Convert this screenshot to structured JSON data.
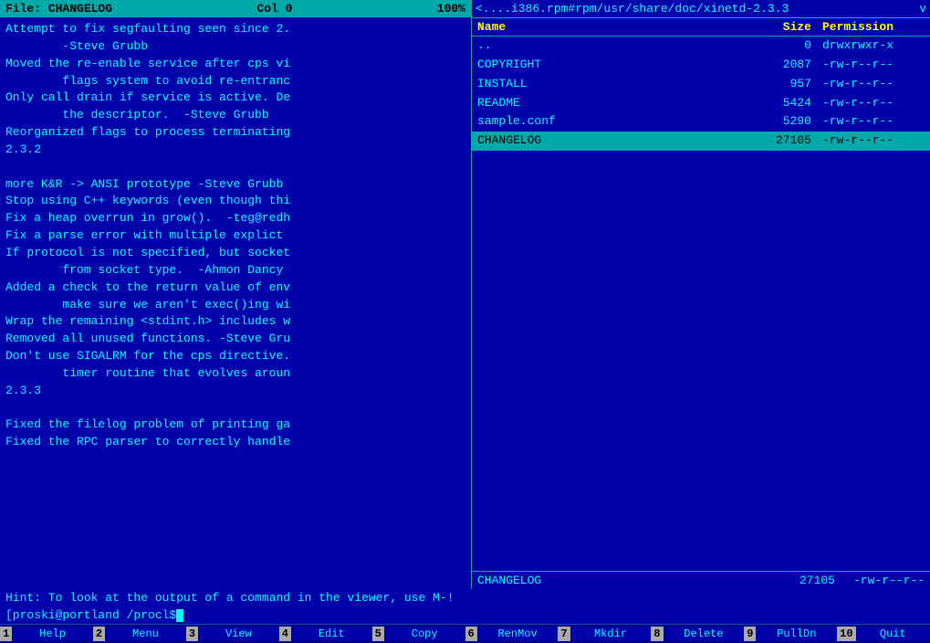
{
  "left": {
    "header": {
      "file_label": "File: CHANGELOG",
      "col_label": "Col 0",
      "percent": "100%"
    },
    "lines": [
      "Attempt to fix segfaulting seen since 2.",
      "        -Steve Grubb",
      "Moved the re-enable service after cps vi",
      "        flags system to avoid re-entranc",
      "Only call drain if service is active. De",
      "        the descriptor.  -Steve Grubb",
      "Reorganized flags to process terminating"
    ],
    "version1": "2.3.2",
    "lines2": [
      "",
      "more K&R -> ANSI prototype -Steve Grubb",
      "Stop using C++ keywords (even though thi",
      "Fix a heap overrun in grow().  -teg@redh",
      "Fix a parse error with multiple explict",
      "If protocol is not specified, but socket",
      "        from socket type.  -Ahmon Dancy",
      "Added a check to the return value of env",
      "        make sure we aren't exec()ing wi",
      "Wrap the remaining <stdint.h> includes w",
      "Removed all unused functions. -Steve Gru",
      "Don't use SIGALRM for the cps directive.",
      "        timer routine that evolves aroun"
    ],
    "version2": "2.3.3",
    "lines3": [
      "",
      "Fixed the filelog problem of printing ga",
      "Fixed the RPC parser to correctly handle"
    ]
  },
  "right": {
    "header_path": "<....i386.rpm#rpm/usr/share/doc/xinetd-2.3.3",
    "columns": {
      "name": "Name",
      "size": "Size",
      "permission": "Permission"
    },
    "files": [
      {
        "name": "..",
        "size": "0",
        "perm": "drwxrwxr-x",
        "selected": false
      },
      {
        "name": "COPYRIGHT",
        "size": "2087",
        "perm": "-rw-r--r--",
        "selected": false
      },
      {
        "name": "INSTALL",
        "size": "957",
        "perm": "-rw-r--r--",
        "selected": false
      },
      {
        "name": "README",
        "size": "5424",
        "perm": "-rw-r--r--",
        "selected": false
      },
      {
        "name": "sample.conf",
        "size": "5290",
        "perm": "-rw-r--r--",
        "selected": false
      },
      {
        "name": "CHANGELOG",
        "size": "27105",
        "perm": "-rw-r--r--",
        "selected": true
      }
    ],
    "status": {
      "name": "CHANGELOG",
      "size": "27105",
      "perm": "-rw-r--r--"
    }
  },
  "hint": "Hint: To look at the output of a command in the viewer, use M-!",
  "prompt": "[proski@portland /procl$",
  "funckeys": [
    {
      "num": "1",
      "label": "Help"
    },
    {
      "num": "2",
      "label": "Menu"
    },
    {
      "num": "3",
      "label": "View"
    },
    {
      "num": "4",
      "label": "Edit"
    },
    {
      "num": "5",
      "label": "Copy"
    },
    {
      "num": "6",
      "label": "RenMov"
    },
    {
      "num": "7",
      "label": "Mkdir"
    },
    {
      "num": "8",
      "label": "Delete"
    },
    {
      "num": "9",
      "label": "PullDn"
    },
    {
      "num": "10",
      "label": "Quit"
    }
  ]
}
